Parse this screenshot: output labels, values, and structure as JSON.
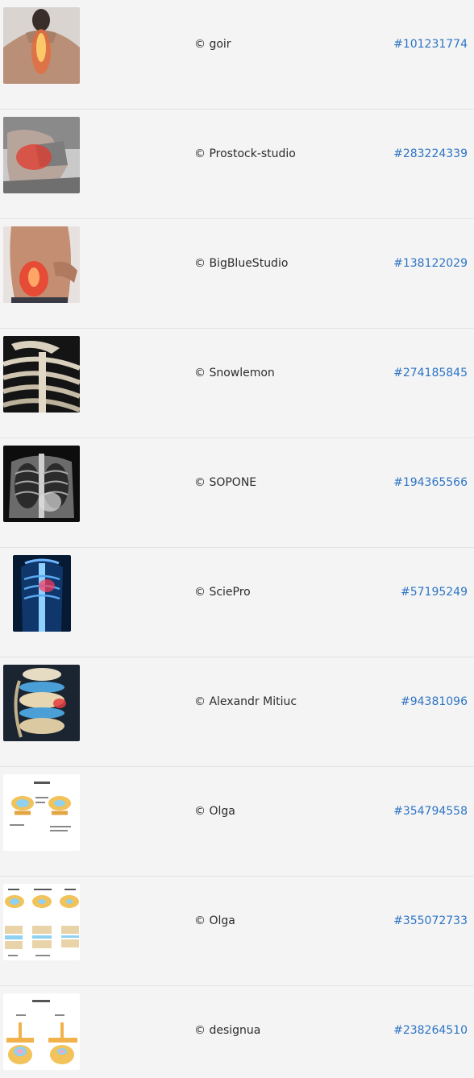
{
  "results": [
    {
      "credit": "© goir",
      "id": "#101231774",
      "thumb": "upper-back-pain-photo"
    },
    {
      "credit": "© Prostock-studio",
      "id": "#283224339",
      "thumb": "lower-back-pain-photo"
    },
    {
      "credit": "© BigBlueStudio",
      "id": "#138122029",
      "thumb": "back-spine-pain-photo"
    },
    {
      "credit": "© Snowlemon",
      "id": "#274185845",
      "thumb": "skeleton-ribcage-render"
    },
    {
      "credit": "© SOPONE",
      "id": "#194365566",
      "thumb": "chest-xray-image"
    },
    {
      "credit": "© SciePro",
      "id": "#57195249",
      "thumb": "blue-spine-xray-illustration"
    },
    {
      "credit": "© Alexandr Mitiuc",
      "id": "#94381096",
      "thumb": "herniated-disc-render"
    },
    {
      "credit": "© Olga",
      "id": "#354794558",
      "thumb": "stenosis-diagram"
    },
    {
      "credit": "© Olga",
      "id": "#355072733",
      "thumb": "spinal-stenosis-stages-diagram"
    },
    {
      "credit": "© designua",
      "id": "#238264510",
      "thumb": "stenosis-vertebra-diagram"
    }
  ],
  "colors": {
    "background": "#f4f4f4",
    "divider": "#e2e2e2",
    "link": "#2d74c4",
    "text": "#2c2c2c"
  }
}
